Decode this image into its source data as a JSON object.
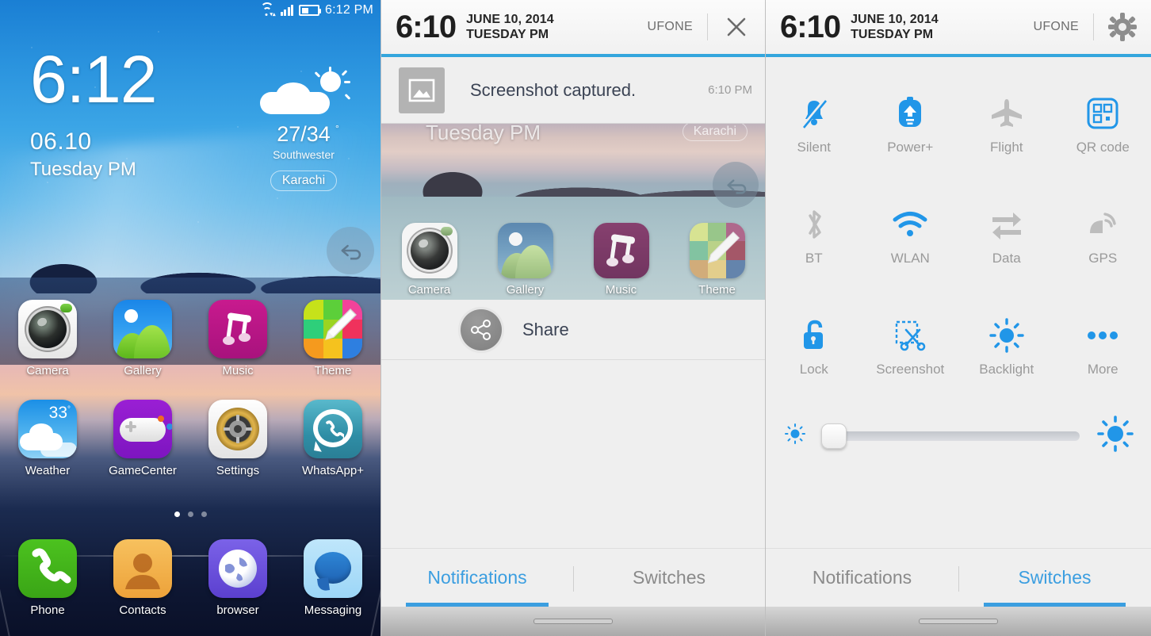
{
  "home": {
    "statusbar": {
      "time": "6:12 PM",
      "wifi_icon": "wifi-icon",
      "signal_icon": "signal-bars-icon",
      "battery_icon": "battery-icon",
      "battery_level_pct": 40
    },
    "clock_widget": {
      "time": "6:12",
      "date": "06.10",
      "day": "Tuesday PM"
    },
    "weather_widget": {
      "icon": "partly-cloudy-icon",
      "temperature": "27/34",
      "degree": "°",
      "description": "Southwester",
      "city": "Karachi"
    },
    "back_button": {
      "icon": "back-arrow-icon"
    },
    "apps": [
      {
        "label": "Camera",
        "icon": "camera-icon"
      },
      {
        "label": "Gallery",
        "icon": "gallery-icon"
      },
      {
        "label": "Music",
        "icon": "music-icon"
      },
      {
        "label": "Theme",
        "icon": "theme-icon"
      },
      {
        "label": "Weather",
        "icon": "weather-icon",
        "badge": "33",
        "badge_unit": "°"
      },
      {
        "label": "GameCenter",
        "icon": "gamepad-icon"
      },
      {
        "label": "Settings",
        "icon": "gear-icon"
      },
      {
        "label": "WhatsApp+",
        "icon": "whatsapp-icon"
      }
    ],
    "page_dots": {
      "count": 3,
      "active_index": 0
    },
    "dock": [
      {
        "label": "Phone",
        "icon": "phone-icon"
      },
      {
        "label": "Contacts",
        "icon": "person-icon"
      },
      {
        "label": "browser",
        "icon": "globe-icon"
      },
      {
        "label": "Messaging",
        "icon": "speech-bubble-icon"
      }
    ]
  },
  "notifications_panel": {
    "header": {
      "clock": "6:10",
      "date": "JUNE 10, 2014",
      "day": "TUESDAY PM",
      "carrier": "UFONE",
      "action_icon": "close-icon"
    },
    "notification": {
      "thumb_icon": "image-placeholder-icon",
      "title": "Screenshot captured.",
      "time": "6:10 PM"
    },
    "preview": {
      "overlay_day": "Tuesday PM",
      "overlay_city": "Karachi",
      "back_icon": "back-arrow-icon",
      "apps": [
        {
          "label": "Camera",
          "icon": "camera-icon"
        },
        {
          "label": "Gallery",
          "icon": "gallery-icon"
        },
        {
          "label": "Music",
          "icon": "music-icon"
        },
        {
          "label": "Theme",
          "icon": "theme-icon"
        }
      ]
    },
    "share": {
      "icon": "share-icon",
      "label": "Share"
    },
    "tabs": [
      {
        "label": "Notifications",
        "active": true
      },
      {
        "label": "Switches",
        "active": false
      }
    ]
  },
  "switches_panel": {
    "header": {
      "clock": "6:10",
      "date": "JUNE 10, 2014",
      "day": "TUESDAY PM",
      "carrier": "UFONE",
      "action_icon": "gear-icon"
    },
    "switches": [
      {
        "label": "Silent",
        "icon": "bell-off-icon",
        "on": true
      },
      {
        "label": "Power+",
        "icon": "power-boost-icon",
        "on": true
      },
      {
        "label": "Flight",
        "icon": "airplane-icon",
        "on": false
      },
      {
        "label": "QR code",
        "icon": "qr-code-icon",
        "on": true
      },
      {
        "label": "BT",
        "icon": "bluetooth-icon",
        "on": false
      },
      {
        "label": "WLAN",
        "icon": "wifi-icon",
        "on": true
      },
      {
        "label": "Data",
        "icon": "data-arrows-icon",
        "on": false
      },
      {
        "label": "GPS",
        "icon": "gps-icon",
        "on": false
      },
      {
        "label": "Lock",
        "icon": "unlock-icon",
        "on": true
      },
      {
        "label": "Screenshot",
        "icon": "scissors-icon",
        "on": true
      },
      {
        "label": "Backlight",
        "icon": "sun-icon",
        "on": true
      },
      {
        "label": "More",
        "icon": "ellipsis-icon",
        "on": true
      }
    ],
    "brightness": {
      "low_icon": "brightness-low-icon",
      "high_icon": "brightness-high-icon",
      "value_pct": 3
    },
    "tabs": [
      {
        "label": "Notifications",
        "active": false
      },
      {
        "label": "Switches",
        "active": true
      }
    ]
  },
  "colors": {
    "accent_blue": "#3b9ee0",
    "rule_blue": "#34a6dd",
    "switch_on": "#2196e8",
    "switch_off": "#bdbdbd",
    "panel_bg": "#efefef",
    "text_dark": "#3b4354",
    "text_muted": "#9a9a9a"
  }
}
